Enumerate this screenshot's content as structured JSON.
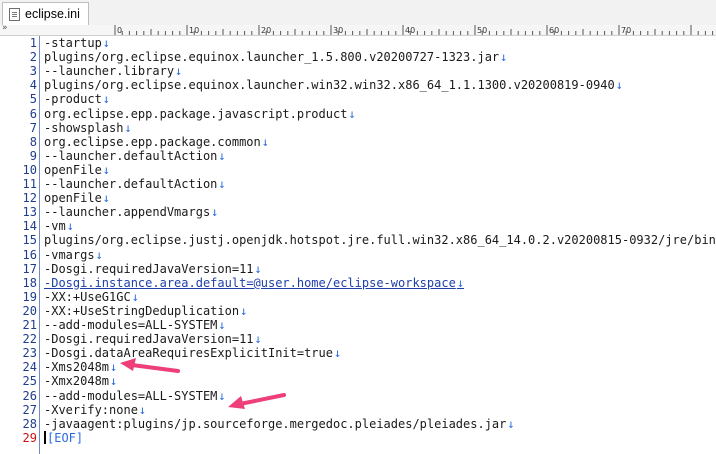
{
  "tab": {
    "label": "eclipse.ini",
    "icon": "file-icon"
  },
  "ruler": {
    "corner": "»",
    "ticks": [
      "0",
      "10",
      "20",
      "30",
      "40",
      "50",
      "60",
      "70"
    ]
  },
  "colors": {
    "line_number": "#1f3c8f",
    "current_line_number": "#d01010",
    "eol_marker": "#2a6be0",
    "link_text": "#1f3fa8",
    "annotation_arrow": "#ee3f7a"
  },
  "eol_symbol": "↓",
  "lines": [
    {
      "n": "1",
      "text": "-startup"
    },
    {
      "n": "2",
      "text": "plugins/org.eclipse.equinox.launcher_1.5.800.v20200727-1323.jar"
    },
    {
      "n": "3",
      "text": "--launcher.library"
    },
    {
      "n": "4",
      "text": "plugins/org.eclipse.equinox.launcher.win32.win32.x86_64_1.1.1300.v20200819-0940"
    },
    {
      "n": "5",
      "text": "-product"
    },
    {
      "n": "6",
      "text": "org.eclipse.epp.package.javascript.product"
    },
    {
      "n": "7",
      "text": "-showsplash"
    },
    {
      "n": "8",
      "text": "org.eclipse.epp.package.common"
    },
    {
      "n": "9",
      "text": "--launcher.defaultAction"
    },
    {
      "n": "10",
      "text": "openFile"
    },
    {
      "n": "11",
      "text": "--launcher.defaultAction"
    },
    {
      "n": "12",
      "text": "openFile"
    },
    {
      "n": "13",
      "text": "--launcher.appendVmargs"
    },
    {
      "n": "14",
      "text": "-vm"
    },
    {
      "n": "15",
      "text": "plugins/org.eclipse.justj.openjdk.hotspot.jre.full.win32.x86_64_14.0.2.v20200815-0932/jre/bin"
    },
    {
      "n": "16",
      "text": "-vmargs"
    },
    {
      "n": "17",
      "text": "-Dosgi.requiredJavaVersion=11"
    },
    {
      "n": "18",
      "text": "-Dosgi.instance.area.default=@user.home/eclipse-workspace"
    },
    {
      "n": "19",
      "text": "-XX:+UseG1GC"
    },
    {
      "n": "20",
      "text": "-XX:+UseStringDeduplication"
    },
    {
      "n": "21",
      "text": "--add-modules=ALL-SYSTEM"
    },
    {
      "n": "22",
      "text": "-Dosgi.requiredJavaVersion=11"
    },
    {
      "n": "23",
      "text": "-Dosgi.dataAreaRequiresExplicitInit=true"
    },
    {
      "n": "24",
      "text": "-Xms2048m"
    },
    {
      "n": "25",
      "text": "-Xmx2048m"
    },
    {
      "n": "26",
      "text": "--add-modules=ALL-SYSTEM"
    },
    {
      "n": "27",
      "text": "-Xverify:none"
    },
    {
      "n": "28",
      "text": "-javaagent:plugins/jp.sourceforge.mergedoc.pleiades/pleiades.jar"
    },
    {
      "n": "29",
      "text": ""
    }
  ],
  "eof_marker": "[EOF]"
}
